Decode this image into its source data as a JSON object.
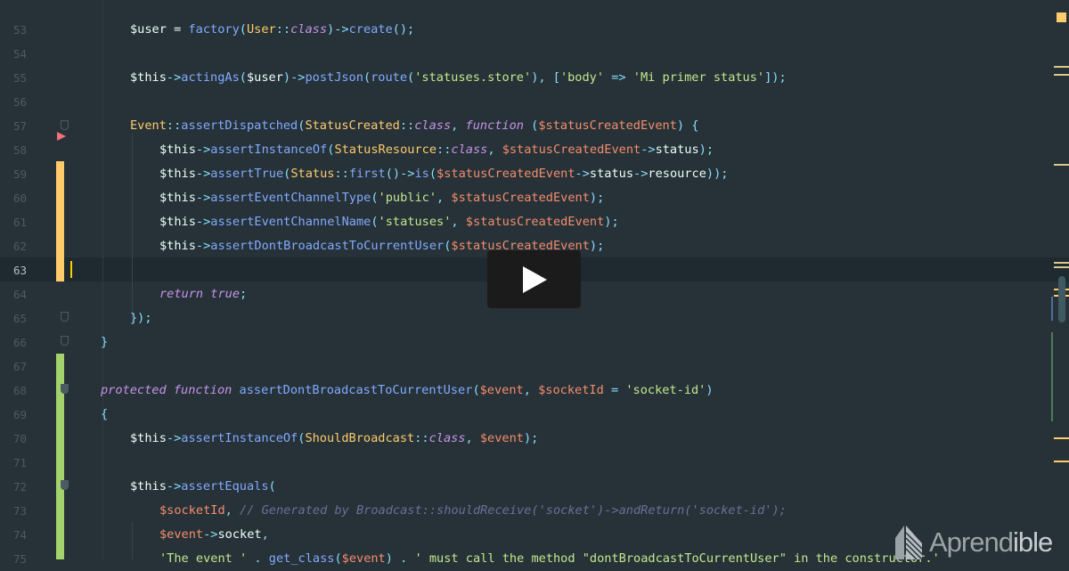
{
  "editor": {
    "current_line": 63,
    "lines": [
      {
        "n": 53,
        "i": 2,
        "t": [
          [
            "v",
            "$user"
          ],
          [
            "t",
            " = "
          ],
          [
            "f",
            "factory"
          ],
          [
            "p",
            "("
          ],
          [
            "c",
            "User"
          ],
          [
            "p",
            "::"
          ],
          [
            "k",
            "class"
          ],
          [
            "p",
            ")->"
          ],
          [
            "f",
            "create"
          ],
          [
            "p",
            "();"
          ]
        ]
      },
      {
        "n": 54,
        "i": 0,
        "t": []
      },
      {
        "n": 55,
        "i": 2,
        "t": [
          [
            "v",
            "$this"
          ],
          [
            "p",
            "->"
          ],
          [
            "f",
            "actingAs"
          ],
          [
            "p",
            "("
          ],
          [
            "v",
            "$user"
          ],
          [
            "p",
            ")->"
          ],
          [
            "f",
            "postJson"
          ],
          [
            "p",
            "("
          ],
          [
            "f",
            "route"
          ],
          [
            "p",
            "("
          ],
          [
            "s",
            "'statuses.store'"
          ],
          [
            "p",
            "), ["
          ],
          [
            "s",
            "'body'"
          ],
          [
            "p",
            " => "
          ],
          [
            "s",
            "'Mi primer status'"
          ],
          [
            "p",
            "]);"
          ]
        ]
      },
      {
        "n": 56,
        "i": 0,
        "t": []
      },
      {
        "n": 57,
        "i": 2,
        "t": [
          [
            "c",
            "Event"
          ],
          [
            "p",
            "::"
          ],
          [
            "f",
            "assertDispatched"
          ],
          [
            "p",
            "("
          ],
          [
            "c",
            "StatusCreated"
          ],
          [
            "p",
            "::"
          ],
          [
            "k",
            "class"
          ],
          [
            "p",
            ", "
          ],
          [
            "k",
            "function"
          ],
          [
            "p",
            " ("
          ],
          [
            "vv",
            "$statusCreatedEvent"
          ],
          [
            "p",
            ") {"
          ]
        ]
      },
      {
        "n": 58,
        "i": 3,
        "t": [
          [
            "v",
            "$this"
          ],
          [
            "p",
            "->"
          ],
          [
            "f",
            "assertInstanceOf"
          ],
          [
            "p",
            "("
          ],
          [
            "c",
            "StatusResource"
          ],
          [
            "p",
            "::"
          ],
          [
            "k",
            "class"
          ],
          [
            "p",
            ", "
          ],
          [
            "vv",
            "$statusCreatedEvent"
          ],
          [
            "p",
            "->"
          ],
          [
            "t",
            "status"
          ],
          [
            "p",
            ");"
          ]
        ]
      },
      {
        "n": 59,
        "i": 3,
        "t": [
          [
            "v",
            "$this"
          ],
          [
            "p",
            "->"
          ],
          [
            "f",
            "assertTrue"
          ],
          [
            "p",
            "("
          ],
          [
            "c",
            "Status"
          ],
          [
            "p",
            "::"
          ],
          [
            "f",
            "first"
          ],
          [
            "p",
            "()->"
          ],
          [
            "f",
            "is"
          ],
          [
            "p",
            "("
          ],
          [
            "vv",
            "$statusCreatedEvent"
          ],
          [
            "p",
            "->"
          ],
          [
            "t",
            "status"
          ],
          [
            "p",
            "->"
          ],
          [
            "t",
            "resource"
          ],
          [
            "p",
            "));"
          ]
        ]
      },
      {
        "n": 60,
        "i": 3,
        "t": [
          [
            "v",
            "$this"
          ],
          [
            "p",
            "->"
          ],
          [
            "f",
            "assertEventChannelType"
          ],
          [
            "p",
            "("
          ],
          [
            "s",
            "'public'"
          ],
          [
            "p",
            ", "
          ],
          [
            "vv",
            "$statusCreatedEvent"
          ],
          [
            "p",
            ");"
          ]
        ]
      },
      {
        "n": 61,
        "i": 3,
        "t": [
          [
            "v",
            "$this"
          ],
          [
            "p",
            "->"
          ],
          [
            "f",
            "assertEventChannelName"
          ],
          [
            "p",
            "("
          ],
          [
            "s",
            "'statuses'"
          ],
          [
            "p",
            ", "
          ],
          [
            "vv",
            "$statusCreatedEvent"
          ],
          [
            "p",
            ");"
          ]
        ]
      },
      {
        "n": 62,
        "i": 3,
        "t": [
          [
            "v",
            "$this"
          ],
          [
            "p",
            "->"
          ],
          [
            "f",
            "assertDontBroadcastToCurrentUser"
          ],
          [
            "p",
            "("
          ],
          [
            "vv",
            "$statusCreatedEvent"
          ],
          [
            "p",
            ");"
          ]
        ]
      },
      {
        "n": 63,
        "i": 0,
        "t": []
      },
      {
        "n": 64,
        "i": 3,
        "t": [
          [
            "k",
            "return"
          ],
          [
            "t",
            " "
          ],
          [
            "k",
            "true"
          ],
          [
            "p",
            ";"
          ]
        ]
      },
      {
        "n": 65,
        "i": 2,
        "t": [
          [
            "p",
            "});"
          ]
        ]
      },
      {
        "n": 66,
        "i": 1,
        "t": [
          [
            "p",
            "}"
          ]
        ]
      },
      {
        "n": 67,
        "i": 0,
        "t": []
      },
      {
        "n": 68,
        "i": 1,
        "t": [
          [
            "k",
            "protected"
          ],
          [
            "t",
            " "
          ],
          [
            "k",
            "function"
          ],
          [
            "t",
            " "
          ],
          [
            "f",
            "assertDontBroadcastToCurrentUser"
          ],
          [
            "p",
            "("
          ],
          [
            "vv",
            "$event"
          ],
          [
            "p",
            ", "
          ],
          [
            "vv",
            "$socketId"
          ],
          [
            "p",
            " = "
          ],
          [
            "s",
            "'socket-id'"
          ],
          [
            "p",
            ")"
          ]
        ]
      },
      {
        "n": 69,
        "i": 1,
        "t": [
          [
            "p",
            "{"
          ]
        ]
      },
      {
        "n": 70,
        "i": 2,
        "t": [
          [
            "v",
            "$this"
          ],
          [
            "p",
            "->"
          ],
          [
            "f",
            "assertInstanceOf"
          ],
          [
            "p",
            "("
          ],
          [
            "c",
            "ShouldBroadcast"
          ],
          [
            "p",
            "::"
          ],
          [
            "k",
            "class"
          ],
          [
            "p",
            ", "
          ],
          [
            "vv",
            "$event"
          ],
          [
            "p",
            ");"
          ]
        ]
      },
      {
        "n": 71,
        "i": 0,
        "t": []
      },
      {
        "n": 72,
        "i": 2,
        "t": [
          [
            "v",
            "$this"
          ],
          [
            "p",
            "->"
          ],
          [
            "f",
            "assertEquals"
          ],
          [
            "p",
            "("
          ]
        ]
      },
      {
        "n": 73,
        "i": 3,
        "t": [
          [
            "vv",
            "$socketId"
          ],
          [
            "p",
            ", "
          ],
          [
            "cm",
            "// Generated by Broadcast::shouldReceive('socket')->andReturn('socket-id');"
          ]
        ]
      },
      {
        "n": 74,
        "i": 3,
        "t": [
          [
            "vv",
            "$event"
          ],
          [
            "p",
            "->"
          ],
          [
            "t",
            "socket"
          ],
          [
            "p",
            ","
          ]
        ]
      },
      {
        "n": 75,
        "i": 3,
        "t": [
          [
            "s",
            "'The event '"
          ],
          [
            "p",
            " . "
          ],
          [
            "f",
            "get_class"
          ],
          [
            "p",
            "("
          ],
          [
            "vv",
            "$event"
          ],
          [
            "p",
            ")"
          ],
          [
            "p",
            " . "
          ],
          [
            "s",
            "' must call the method \"dontBroadcastToCurrentUser\" in the constructor.'"
          ]
        ]
      }
    ]
  },
  "video": {
    "play_icon": "play-icon"
  },
  "watermark": {
    "brand_light": "Apr",
    "brand_mid": "end",
    "brand_bold": "ible"
  }
}
